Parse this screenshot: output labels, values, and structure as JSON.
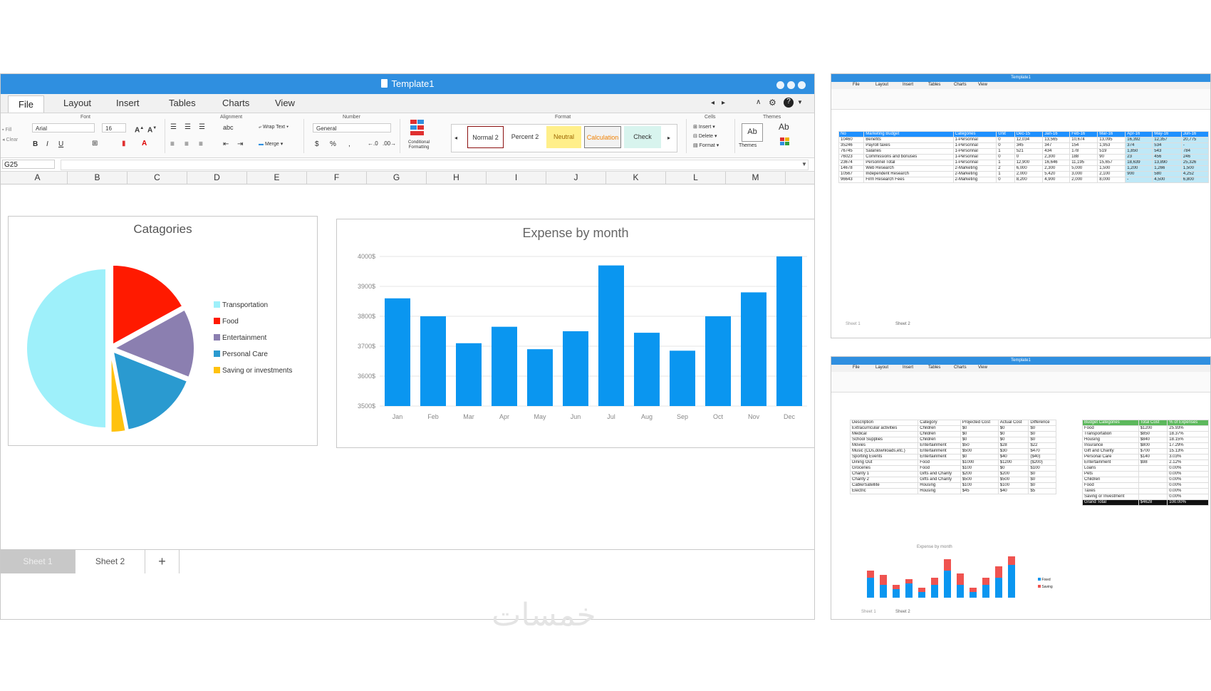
{
  "main_window": {
    "title": "Template1",
    "tabs": [
      "File",
      "Layout",
      "Insert",
      "Tables",
      "Charts",
      "View"
    ],
    "ribbon": {
      "font_group": "Font",
      "font_name": "Arial",
      "font_size": "16",
      "alignment_group": "Alignment",
      "wrap_text": "Wrap Text",
      "merge": "Merge",
      "abc": "abc",
      "number_group": "Number",
      "number_format": "General",
      "currency": "$",
      "percent": "%",
      "comma": ",",
      "conditional_formatting": "Conditional Formatting",
      "format_group": "Format",
      "styles": [
        "Normal 2",
        "Percent 2",
        "Neutral",
        "Calculation",
        "Check"
      ],
      "cells_group": "Cells",
      "insert": "Insert",
      "delete": "Delete",
      "format": "Format",
      "themes_group": "Themes",
      "themes": "Themes",
      "ab": "Ab",
      "fill": "Fill",
      "clear": "Clear"
    },
    "name_box": "G25",
    "columns": [
      "A",
      "B",
      "C",
      "D",
      "E",
      "F",
      "G",
      "H",
      "I",
      "J",
      "K",
      "L",
      "M"
    ],
    "sheet_tabs": [
      "Sheet 1",
      "Sheet 2"
    ],
    "add_sheet": "+"
  },
  "chart_data": [
    {
      "type": "pie",
      "title": "Catagories",
      "categories": [
        "Transportation",
        "Food",
        "Entertainment",
        "Personal Care",
        "Saving or investments"
      ],
      "values": [
        50,
        17,
        14,
        16,
        3
      ],
      "colors": [
        "#9ef0fa",
        "#ff1a00",
        "#8b7fb0",
        "#2a9ad0",
        "#ffc20e"
      ],
      "legend": "right"
    },
    {
      "type": "bar",
      "title": "Expense by month",
      "categories": [
        "Jan",
        "Feb",
        "Mar",
        "Apr",
        "May",
        "Jun",
        "Jul",
        "Aug",
        "Sep",
        "Oct",
        "Nov",
        "Dec"
      ],
      "values": [
        3860,
        3800,
        3710,
        3765,
        3690,
        3750,
        3970,
        3745,
        3685,
        3800,
        3880,
        4000
      ],
      "ylim": [
        3500,
        4000
      ],
      "yticks": [
        3500,
        3600,
        3700,
        3800,
        3900,
        4000
      ],
      "ytick_labels": [
        "3500$",
        "3600$",
        "3700$",
        "3800$",
        "3900$",
        "4000$"
      ],
      "color": "#0a96f0",
      "grid": true
    }
  ],
  "mini_window_1": {
    "title": "Template1",
    "tabs": [
      "File",
      "Layout",
      "Insert",
      "Tables",
      "Charts",
      "View"
    ],
    "headers": [
      "No",
      "Marketing Budget",
      "Categories",
      "Unit",
      "Dec-15",
      "Jan-16",
      "Feb-16",
      "Mar-16",
      "Apr-16",
      "May-16",
      "Jun-16"
    ],
    "rows": [
      [
        "10460",
        "Benefits",
        "1-Personnal",
        "0",
        "12,034",
        "13,565",
        "10,674",
        "13,095",
        "16,392",
        "12,357",
        "20,775"
      ],
      [
        "35246",
        "Payroll taxes",
        "1-Personnal",
        "0",
        "345",
        "347",
        "154",
        "1,953",
        "374",
        "534",
        "-"
      ],
      [
        "76745",
        "Salaries",
        "1-Personnal",
        "1",
        "521",
        "434",
        "178",
        "519",
        "1,850",
        "543",
        "784"
      ],
      [
        "76023",
        "Commissions and bonuses",
        "1-Personnal",
        "0",
        "0",
        "2,300",
        "188",
        "90",
        "23",
        "456",
        "246"
      ],
      [
        "23674",
        "Personnel Total",
        "1-Personnal",
        "1",
        "12,900",
        "16,646",
        "11,195",
        "15,657",
        "18,639",
        "13,890",
        "25,326"
      ],
      [
        "14678",
        "Web Research",
        "2-Marketing",
        "2",
        "6,000",
        "2,300",
        "5,000",
        "1,500",
        "1,200",
        "1,266",
        "1,500"
      ],
      [
        "10567",
        "Independent Research",
        "2-Marketing",
        "1",
        "2,000",
        "5,420",
        "3,000",
        "2,100",
        "900",
        "580",
        "4,252"
      ],
      [
        "96643",
        "Firm Research Fees",
        "2-Marketing",
        "0",
        "8,200",
        "4,900",
        "2,000",
        "8,000",
        "-",
        "4,500",
        "6,800"
      ]
    ],
    "sheet_tabs": [
      "Sheet 1",
      "Sheet 2"
    ]
  },
  "mini_window_2": {
    "title": "Template1",
    "tabs": [
      "File",
      "Layout",
      "Insert",
      "Tables",
      "Charts",
      "View"
    ],
    "headers": [
      "Description",
      "Category",
      "Projected Cost",
      "Actual Cost",
      "Difference"
    ],
    "rows": [
      [
        "Extracurricular activities",
        "Children",
        "$0",
        "$0",
        "$0"
      ],
      [
        "Medical",
        "Children",
        "$0",
        "$0",
        "$0"
      ],
      [
        "School Supplies",
        "Children",
        "$0",
        "$0",
        "$0"
      ],
      [
        "Movies",
        "Entertainment",
        "$50",
        "$28",
        "$22"
      ],
      [
        "Music (CDs,downloads,etc.)",
        "Entertainment",
        "$500",
        "$30",
        "$470"
      ],
      [
        "Sporting Events",
        "Entertainment",
        "$0",
        "$40",
        "($40)"
      ],
      [
        "Dining Out",
        "Food",
        "$1000",
        "$1200",
        "($200)"
      ],
      [
        "Groceries",
        "Food",
        "$100",
        "$0",
        "$100"
      ],
      [
        "Charity 1",
        "Gifts and Charity",
        "$200",
        "$200",
        "$0"
      ],
      [
        "Charity 2",
        "Gifts and Charity",
        "$500",
        "$500",
        "$0"
      ],
      [
        "Cable/Satellite",
        "Housing",
        "$100",
        "$100",
        "$0"
      ],
      [
        "Electric",
        "Housing",
        "$45",
        "$40",
        "$5"
      ]
    ],
    "summary_header": [
      "Budget Categories",
      "Total Cost",
      "% of Expenses"
    ],
    "summary_rows": [
      [
        "Food",
        "$1200",
        "25.93%"
      ],
      [
        "Transportation",
        "$850",
        "18.37%"
      ],
      [
        "Housing",
        "$840",
        "18.15%"
      ],
      [
        "Insurance",
        "$800",
        "17.29%"
      ],
      [
        "Gift and Charity",
        "$700",
        "15.13%"
      ],
      [
        "Personal Care",
        "$140",
        "3.03%"
      ],
      [
        "Entertainment",
        "$98",
        "2.12%"
      ],
      [
        "Loans",
        "",
        "0.00%"
      ],
      [
        "Pets",
        "",
        "0.00%"
      ],
      [
        "Children",
        "",
        "0.00%"
      ],
      [
        "Food",
        "",
        "0.00%"
      ],
      [
        "Taxes",
        "",
        "0.00%"
      ],
      [
        "Saving or Investment",
        "",
        "0.00%"
      ]
    ],
    "grand_total": [
      "Grand Total",
      "$4628",
      "100.00%"
    ],
    "mini_chart_title": "Expense by month",
    "mini_chart_legend": [
      "Fixed",
      "Saving"
    ],
    "sheet_tabs": [
      "Sheet 1",
      "Sheet 2"
    ]
  },
  "watermark": "خمسات"
}
